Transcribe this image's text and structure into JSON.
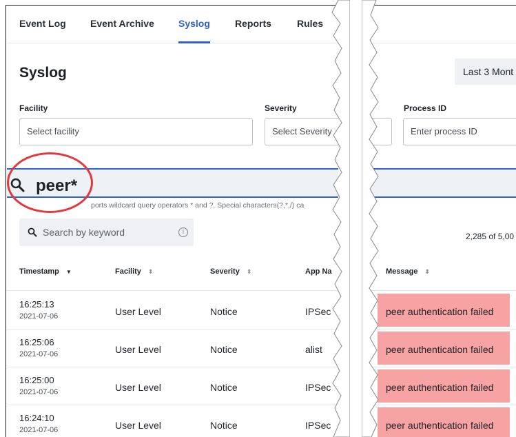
{
  "tabs": [
    "Event Log",
    "Event Archive",
    "Syslog",
    "Reports",
    "Rules"
  ],
  "active_tab": "Syslog",
  "page_title": "Syslog",
  "date_range_button": "Last 3 Mont",
  "filters": {
    "facility": {
      "label": "Facility",
      "placeholder": "Select facility"
    },
    "severity": {
      "label": "Severity",
      "placeholder": "Select Severity"
    },
    "process_id": {
      "label": "Process ID",
      "placeholder": "Enter process ID"
    }
  },
  "query_input": {
    "value": "peer*"
  },
  "query_hint": "ports wildcard query operators * and ?. Special characters(?,*,/) ca",
  "keyword_search": {
    "placeholder": "Search by keyword"
  },
  "result_count": "2,285 of 5,00",
  "table": {
    "columns": [
      "Timestamp",
      "Facility",
      "Severity",
      "App Na",
      "Message"
    ],
    "rows": [
      {
        "time": "16:25:13",
        "date": "2021-07-06",
        "facility": "User Level",
        "severity": "Notice",
        "app": "IPSec",
        "message": "peer authentication failed"
      },
      {
        "time": "16:25:06",
        "date": "2021-07-06",
        "facility": "User Level",
        "severity": "Notice",
        "app": "alist",
        "message": "peer authentication failed"
      },
      {
        "time": "16:25:00",
        "date": "2021-07-06",
        "facility": "User Level",
        "severity": "Notice",
        "app": "IPSec",
        "message": "peer authentication failed"
      },
      {
        "time": "16:24:10",
        "date": "2021-07-06",
        "facility": "User Level",
        "severity": "Notice",
        "app": "IPSec",
        "message": "peer authentication failed"
      }
    ]
  },
  "colors": {
    "accent": "#2e63c7",
    "highlight": "#f7a3a3",
    "annotation_circle": "#e0393e"
  },
  "icons": [
    "search-icon",
    "info-icon",
    "sort-down-icon",
    "sort-icon"
  ]
}
